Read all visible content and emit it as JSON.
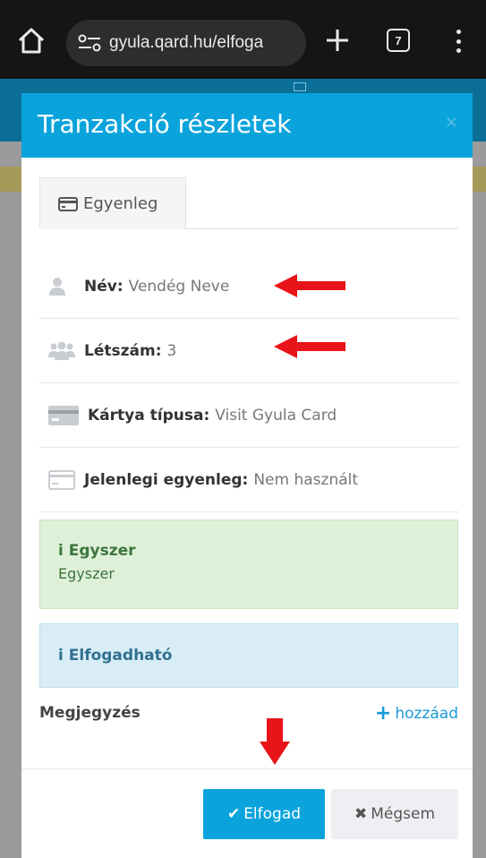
{
  "browser": {
    "url": "gyula.qard.hu/elfoga",
    "tab_count": "7"
  },
  "modal": {
    "title": "Tranzakció részletek",
    "close_glyph": "×",
    "tab_label": "Egyenleg",
    "fields": [
      {
        "label": "Név:",
        "value": "Vendég Neve",
        "icon": "user-icon"
      },
      {
        "label": "Létszám:",
        "value": "3",
        "icon": "users-icon"
      },
      {
        "label": "Kártya típusa:",
        "value": "Visit Gyula Card",
        "icon": "credit-card-icon"
      },
      {
        "label": "Jelenlegi egyenleg:",
        "value": "Nem használt",
        "icon": "credit-card-outline-icon"
      }
    ],
    "alert_success": {
      "title": "Egyszer",
      "body": "Egyszer"
    },
    "alert_info": {
      "title": "Elfogadható"
    },
    "info_glyph": "i",
    "note_label": "Megjegyzés",
    "note_add_label": "hozzáad",
    "accept_label": "Elfogad",
    "cancel_label": "Mégsem"
  },
  "colors": {
    "accent": "#0aa3dc",
    "annotation_arrow": "#e8141a",
    "success_bg": "#dff0d8",
    "info_bg": "#d9edf7"
  }
}
